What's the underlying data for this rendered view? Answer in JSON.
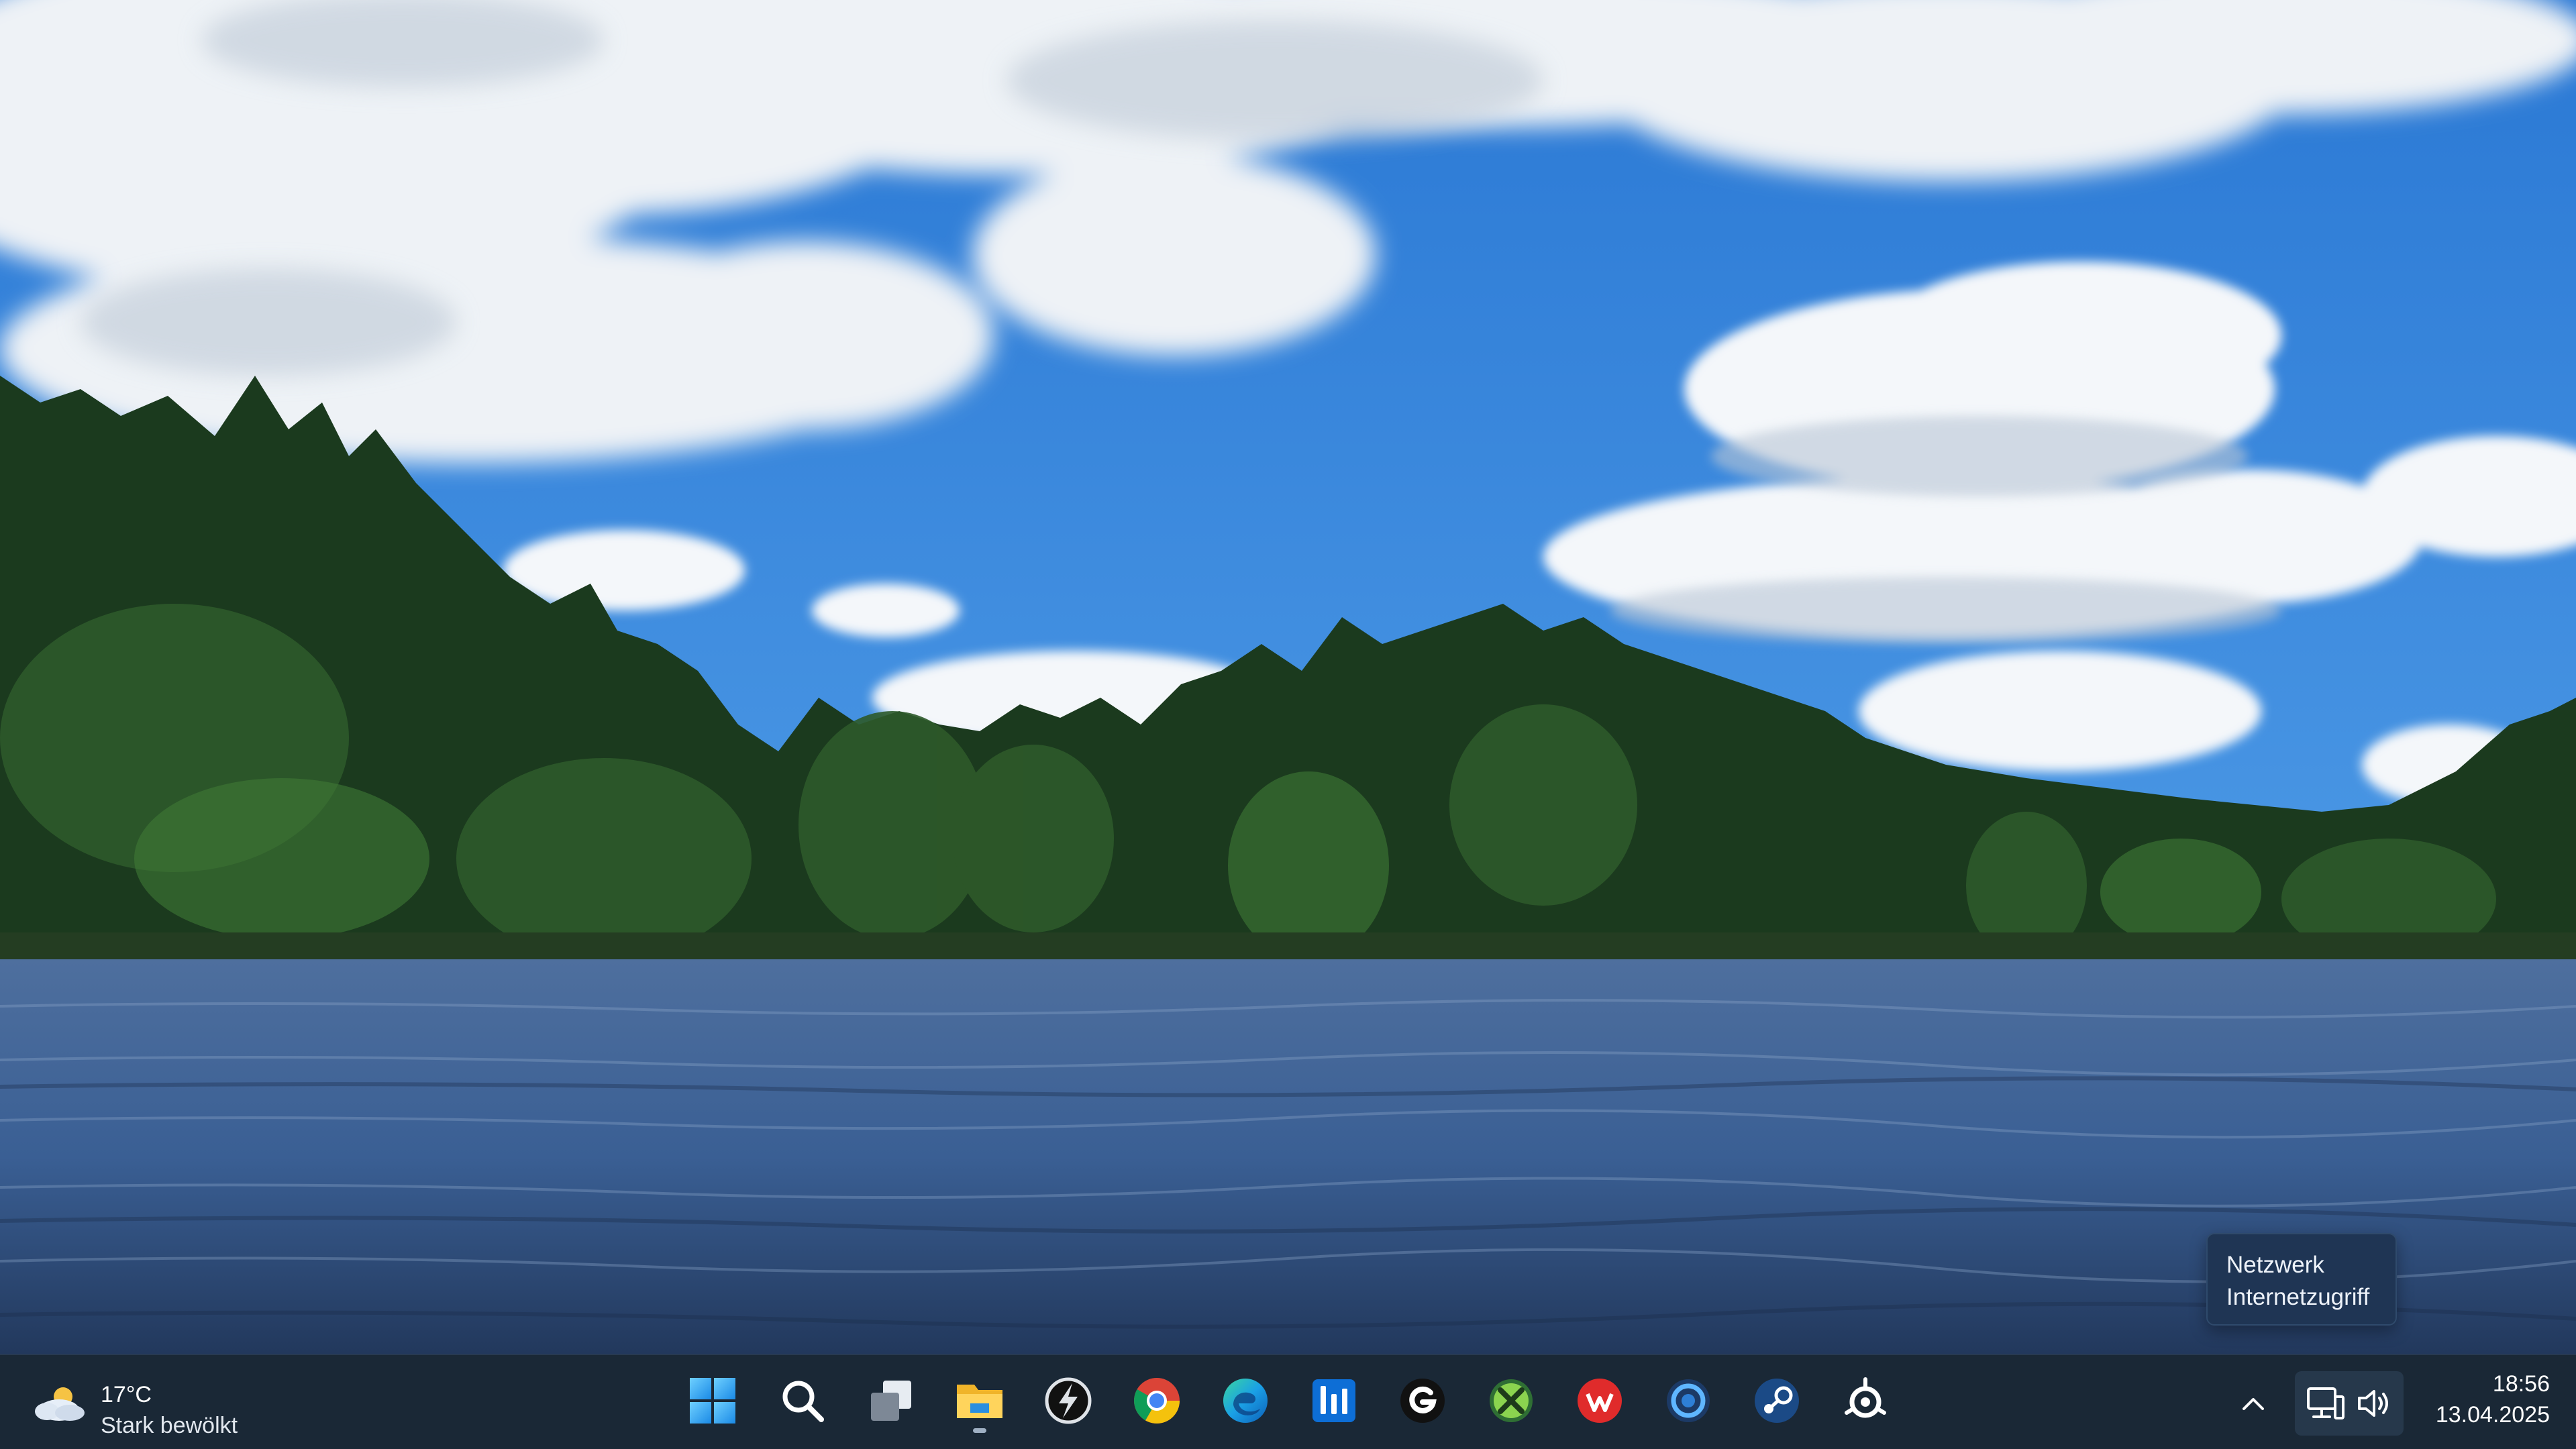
{
  "tooltip": {
    "line1": "Netzwerk",
    "line2": "Internetzugriff"
  },
  "weather": {
    "icon": "cloud-sun-icon",
    "temperature": "17°C",
    "condition": "Stark bewölkt"
  },
  "taskbar": {
    "apps": [
      {
        "name": "start-button",
        "icon": "windows-logo-icon"
      },
      {
        "name": "search-button",
        "icon": "search-icon"
      },
      {
        "name": "task-view-button",
        "icon": "task-view-icon"
      },
      {
        "name": "file-explorer-button",
        "icon": "folder-icon",
        "active": true
      },
      {
        "name": "app-ghub-button",
        "icon": "lightning-circle-icon"
      },
      {
        "name": "chrome-button",
        "icon": "chrome-icon"
      },
      {
        "name": "edge-button",
        "icon": "edge-icon"
      },
      {
        "name": "app-equalizer-button",
        "icon": "equalizer-icon"
      },
      {
        "name": "logitech-g-button",
        "icon": "logitech-g-icon"
      },
      {
        "name": "xbox-button",
        "icon": "xbox-icon"
      },
      {
        "name": "wargaming-button",
        "icon": "wargaming-icon"
      },
      {
        "name": "app-ring-button",
        "icon": "ring-icon"
      },
      {
        "name": "steam-button",
        "icon": "steam-icon"
      },
      {
        "name": "steelseries-button",
        "icon": "steelseries-icon"
      }
    ],
    "tray": {
      "overflow_icon": "chevron-up-icon",
      "network_icon": "network-icon",
      "volume_icon": "speaker-icon"
    },
    "clock": {
      "time": "18:56",
      "date": "13.04.2025"
    }
  },
  "colors": {
    "taskbar_bg": "#1a2836",
    "tooltip_bg": "#1f3554",
    "sky": "#2f7fd6",
    "water": "#3a5f94"
  }
}
